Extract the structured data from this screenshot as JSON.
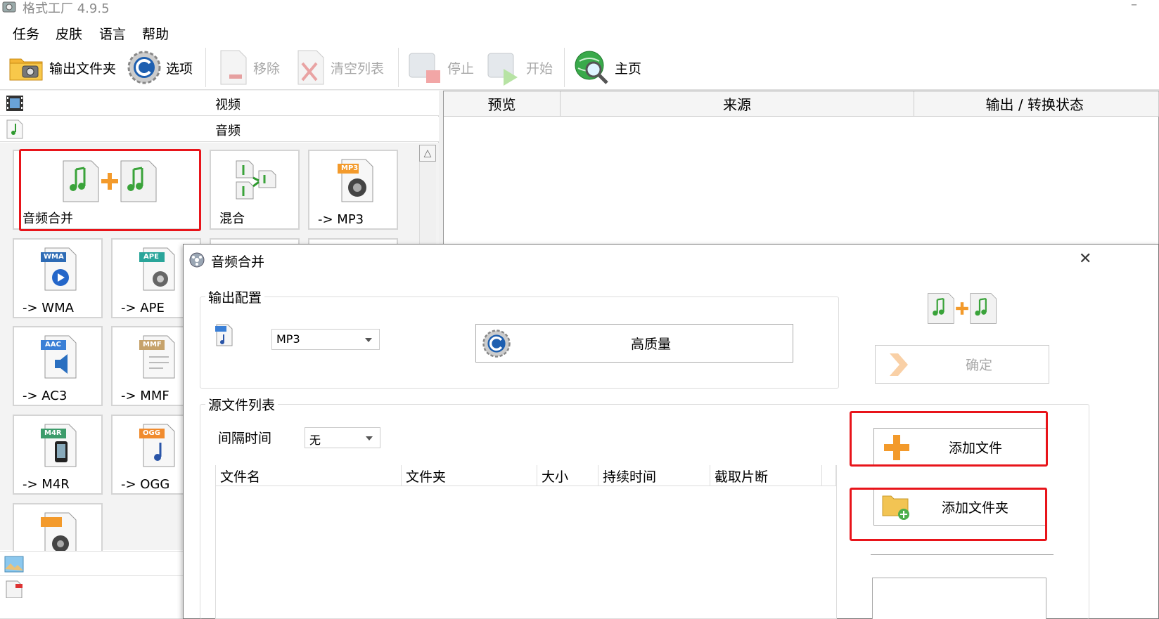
{
  "app": {
    "title": "格式工厂 4.9.5",
    "minimize": "–"
  },
  "menu": [
    "任务",
    "皮肤",
    "语言",
    "帮助"
  ],
  "toolbar": {
    "output_folder": "输出文件夹",
    "options": "选项",
    "remove": "移除",
    "clear_list": "清空列表",
    "stop": "停止",
    "start": "开始",
    "home": "主页"
  },
  "categories": {
    "video": "视频",
    "audio": "音频"
  },
  "tiles": {
    "audio_merge": "音频合并",
    "mix": "混合",
    "to_mp3": "-> MP3",
    "to_wma": "-> WMA",
    "to_ape": "-> APE",
    "to_ac3": "-> AC3",
    "to_mmf": "-> MMF",
    "to_m4r": "-> M4R",
    "to_ogg": "-> OGG"
  },
  "badges": {
    "wma": "WMA",
    "ape": "APE",
    "aac": "AAC",
    "mmf": "MMF",
    "m4r": "M4R",
    "ogg": "OGG",
    "mp3": "MP3"
  },
  "task_columns": {
    "preview": "预览",
    "source": "来源",
    "output_status": "输出 / 转换状态"
  },
  "dialog": {
    "title": "音频合并",
    "close": "✕",
    "output_config_title": "输出配置",
    "format_value": "MP3",
    "quality_button": "高质量",
    "ok_button": "确定",
    "source_list_title": "源文件列表",
    "interval_label": "间隔时间",
    "interval_value": "无",
    "add_file_button": "添加文件",
    "add_folder_button": "添加文件夹",
    "file_columns": [
      "文件名",
      "文件夹",
      "大小",
      "持续时间",
      "截取片断"
    ]
  },
  "colors": {
    "highlight_red": "#e8141a",
    "accent_orange": "#f39a2b",
    "music_green": "#3aa33a"
  }
}
